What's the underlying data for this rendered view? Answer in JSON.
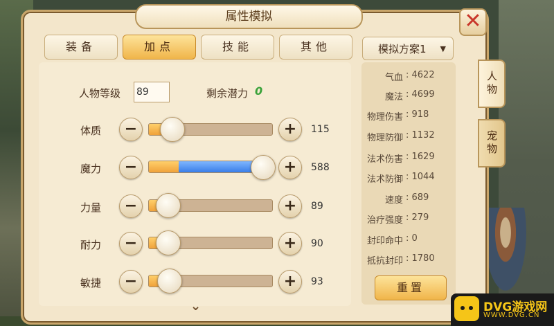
{
  "window": {
    "title": "属性模拟",
    "close_symbol": "✕"
  },
  "tabs": [
    {
      "label": "装备",
      "active": false
    },
    {
      "label": "加点",
      "active": true
    },
    {
      "label": "技能",
      "active": false
    },
    {
      "label": "其他",
      "active": false
    }
  ],
  "level": {
    "label": "人物等级",
    "value": "89"
  },
  "remaining": {
    "label": "剩余潜力",
    "value": "0"
  },
  "attributes": [
    {
      "label": "体质",
      "value": "115",
      "level": 0.19
    },
    {
      "label": "魔力",
      "value": "588",
      "level": 1.0,
      "highlight_from": 0.24
    },
    {
      "label": "力量",
      "value": "89",
      "level": 0.16
    },
    {
      "label": "耐力",
      "value": "90",
      "level": 0.16
    },
    {
      "label": "敏捷",
      "value": "93",
      "level": 0.17
    }
  ],
  "buttons": {
    "minus": "−",
    "plus": "+"
  },
  "more_indicator": "⌄",
  "scheme": {
    "label": "模拟方案1",
    "caret": "▼"
  },
  "stats": [
    {
      "label": "气血",
      "value": ": 4622"
    },
    {
      "label": "魔法",
      "value": ": 4699"
    },
    {
      "label": "物理伤害",
      "value": ": 918"
    },
    {
      "label": "物理防御",
      "value": ": 1132"
    },
    {
      "label": "法术伤害",
      "value": ": 1629"
    },
    {
      "label": "法术防御",
      "value": ": 1044"
    },
    {
      "label": "速度",
      "value": ": 689"
    },
    {
      "label": "治疗强度",
      "value": ": 279"
    },
    {
      "label": "封印命中",
      "value": ": 0"
    },
    {
      "label": "抵抗封印",
      "value": ": 1780"
    }
  ],
  "reset_label": "重置",
  "side_tabs": [
    {
      "label": "人物",
      "active": true
    },
    {
      "label": "宠物",
      "active": false
    }
  ],
  "watermark": {
    "brand": "DVG游戏网",
    "url": "WWW.DVG.CN"
  },
  "colors": {
    "accent_orange": "#f0b54a",
    "magic_blue": "#3a7ee8",
    "close_red": "#c8362a",
    "remaining_green": "#3aa23a"
  }
}
